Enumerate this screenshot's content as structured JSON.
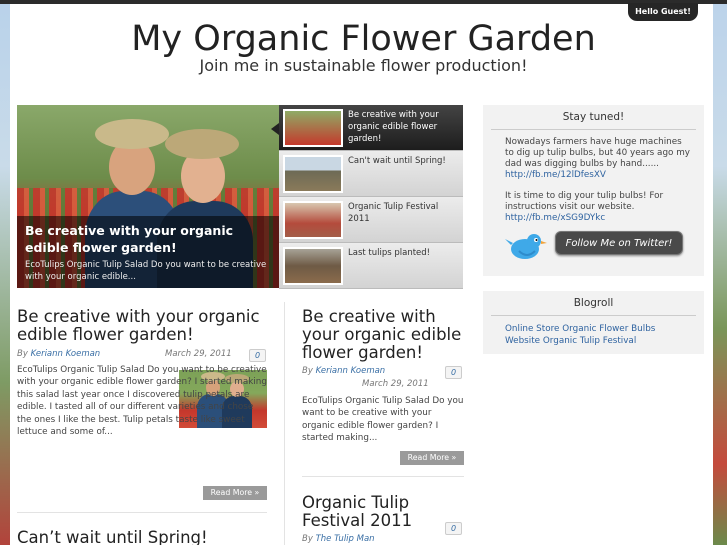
{
  "header": {
    "guest_label": "Hello Guest!",
    "site_title": "My Organic Flower Garden",
    "tagline": "Join me in sustainable flower production!"
  },
  "slider": {
    "main": {
      "title": "Be creative with your organic edible flower garden!",
      "excerpt": "EcoTulips Organic Tulip Salad Do you want to be creative with your organic edible..."
    },
    "thumbs": [
      {
        "label": "Be creative with your organic edible flower garden!",
        "active": true
      },
      {
        "label": "Can't wait until Spring!",
        "active": false
      },
      {
        "label": "Organic Tulip Festival 2011",
        "active": false
      },
      {
        "label": "Last tulips planted!",
        "active": false
      }
    ]
  },
  "posts": {
    "left1": {
      "title": "Be creative with your organic edible flower garden!",
      "by": "By",
      "author": "Keriann Koeman",
      "date": "March 29, 2011",
      "comments": "0",
      "body": "EcoTulips Organic Tulip Salad Do you want to be creative with your organic edible flower garden? I started making this salad last year once I discovered tulip petals are edible. I tasted all of our different varieties and chose the ones I like the best. Tulip petals taste like sweet lettuce and some of...",
      "read_more": "Read More »"
    },
    "left2": {
      "title": "Can’t wait until Spring!"
    },
    "right1": {
      "title": "Be creative with your organic edible flower garden!",
      "by": "By",
      "author": "Keriann Koeman",
      "date": "March 29, 2011",
      "comments": "0",
      "body": "EcoTulips Organic Tulip Salad Do you want to be creative with your organic edible flower garden? I started making...",
      "read_more": "Read More »"
    },
    "right2": {
      "title": "Organic Tulip Festival 2011",
      "by": "By",
      "author": "The Tulip Man",
      "comments": "0"
    }
  },
  "sidebar": {
    "stay_tuned": {
      "title": "Stay tuned!",
      "tweet1_text": "Nowadays farmers have huge machines to dig up tulip bulbs, but 40 years ago my dad was digging bulbs by hand......",
      "tweet1_link": "http://fb.me/12lDfesXV",
      "tweet2_text": "It is time to dig your tulip bulbs! For instructions visit our website.",
      "tweet2_link": "http://fb.me/xSG9DYkc",
      "follow_label": "Follow Me on Twitter!",
      "bird_icon": "twitter-bird-icon"
    },
    "blogroll": {
      "title": "Blogroll",
      "links": [
        "Online Store Organic Flower Bulbs",
        "Website Organic Tulip Festival"
      ]
    }
  },
  "colors": {
    "link": "#2f63a0",
    "dark_bar": "#262626",
    "read_more_bg": "#9a9a9a",
    "widget_bg": "#f2f2f2"
  }
}
